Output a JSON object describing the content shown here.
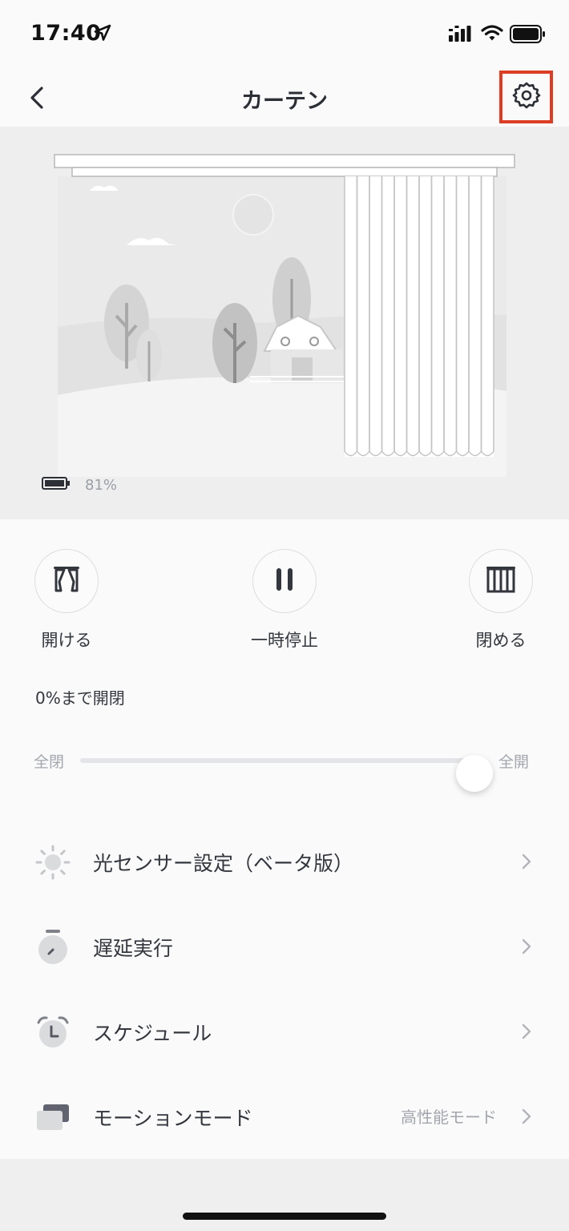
{
  "status_bar": {
    "time": "17:40",
    "location_icon": "location-arrow-icon",
    "signal_icon": "cellular-signal-icon",
    "wifi_icon": "wifi-icon",
    "battery_icon": "battery-icon"
  },
  "nav": {
    "title": "カーテン",
    "back_icon": "chevron-left-icon",
    "settings_icon": "gear-icon",
    "settings_highlight_color": "#dc3d24"
  },
  "device": {
    "battery_icon": "battery-icon",
    "battery_percent": "81%"
  },
  "controls": {
    "open": {
      "label": "開ける",
      "icon": "curtain-open-icon"
    },
    "pause": {
      "label": "一時停止",
      "icon": "pause-icon"
    },
    "close": {
      "label": "閉める",
      "icon": "curtain-closed-icon"
    }
  },
  "position": {
    "text": "0%まで開閉",
    "min_label": "全閉",
    "max_label": "全開",
    "slider_value": 1.0
  },
  "menu": [
    {
      "label": "光センサー設定（ベータ版）",
      "icon": "sun-icon",
      "value": ""
    },
    {
      "label": "遅延実行",
      "icon": "stopwatch-icon",
      "value": ""
    },
    {
      "label": "スケジュール",
      "icon": "alarm-clock-icon",
      "value": ""
    },
    {
      "label": "モーションモード",
      "icon": "layers-icon",
      "value": "高性能モード"
    }
  ],
  "colors": {
    "accent": "#dc3d24",
    "text": "#33363d",
    "muted": "#a3a6ad"
  }
}
